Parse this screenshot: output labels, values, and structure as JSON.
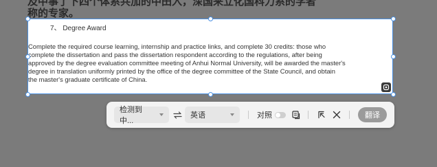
{
  "document": {
    "line1": "及中事了下四个体系共加的中田入，深国来立化国科力系的学者",
    "line2": "称的专家。"
  },
  "textbox": {
    "heading": "7、 Degree Award",
    "paragraph_lines": [
      "Complete the required course learning, internship and practice links, and complete 30 credits: those who",
      "complete the dissertation and pass the dissertation respondent according to the regulations, after being",
      "approved by the degree evaluation committee meeting of Anhui Normal University, will be awarded the master's",
      "degree in translation uniformly printed by the office of the degree committee of the State Council, and obtain",
      "the master's graduate certificate of China."
    ],
    "corner_icon": "ai-chip-icon"
  },
  "toolbar": {
    "source_language": "检测到中...",
    "swap_icon": "swap-arrows-icon",
    "target_language": "英语",
    "compare_label": "对照",
    "compare_enabled": false,
    "icons": [
      "copy-icon",
      "pin-icon",
      "close-icon"
    ],
    "translate_label": "翻译"
  },
  "colors": {
    "selection": "#4a90e2",
    "overlay": "#7b7b7b",
    "translate_button": "#9b9b9b"
  }
}
